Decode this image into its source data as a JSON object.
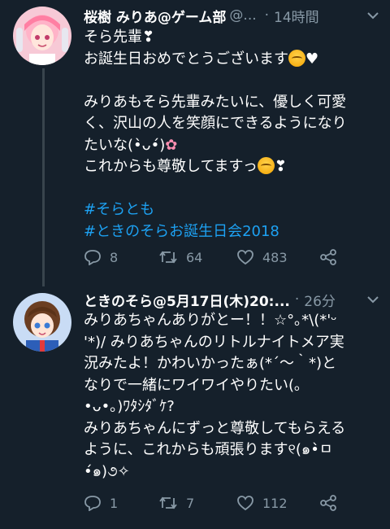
{
  "tweets": [
    {
      "author_name": "桜樹 みりあ@ゲーム部",
      "handle": "@...",
      "time": "14時間",
      "text_lines": [
        "そら先輩❣",
        "お誕生日おめでとうございます",
        "",
        "みりあもそら先輩みたいに、優しく可愛",
        "く、沢山の人を笑顔にできるようになり",
        "たいな(•̀ᴗ•́)",
        "これからも尊敬してますっ"
      ],
      "hashtags": [
        "#そらとも",
        "#ときのそらお誕生日会2018"
      ],
      "replies": "8",
      "retweets": "64",
      "likes": "483"
    },
    {
      "author_name": "ときのそら@5月17日(木)20:...",
      "time": "26分",
      "text_lines": [
        "みりあちゃんありがとー！！☆°｡*\\(*'ᵕ",
        "'*)/ みりあちゃんのリトルナイトメア実",
        "況みたよ！かわいかったぁ(*´～｀*)と",
        "なりで一緒にワイワイやりたい(｡",
        "•ᴗ•｡)ﾜﾀｼﾀﾞｹ?",
        "みりあちゃんにずっと尊敬してもらえる",
        "ように、これからも頑張ります୧(๑•̀ㅁ",
        "•́๑)૭✧"
      ],
      "replies": "1",
      "retweets": "7",
      "likes": "112"
    }
  ],
  "colors": {
    "background": "#15202b",
    "text": "#ffffff",
    "muted": "#8899a6",
    "hashtag": "#1da1f2",
    "thread_line": "#38444d"
  },
  "icons": [
    "reply-icon",
    "retweet-icon",
    "like-icon",
    "share-icon",
    "chevron-down-icon"
  ]
}
